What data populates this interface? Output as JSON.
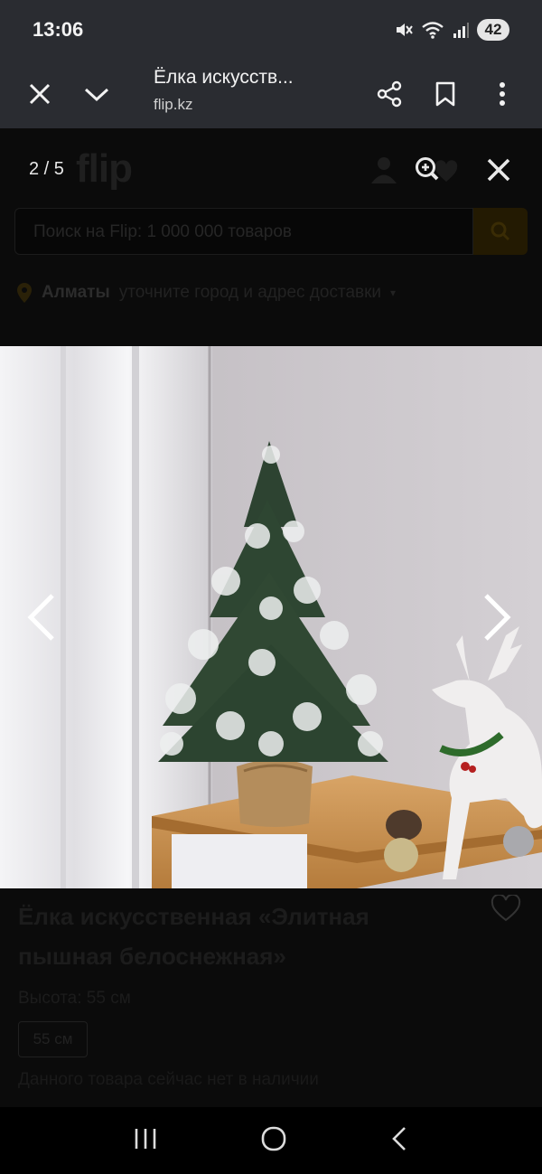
{
  "status": {
    "time": "13:06",
    "battery": "42"
  },
  "browser": {
    "page_title": "Ёлка искусств...",
    "url": "flip.kz"
  },
  "site": {
    "logo_text": "flip",
    "search_placeholder": "Поиск на Flip: 1 000 000 товаров",
    "city": "Алматы",
    "location_hint": "уточните город и адрес доставки",
    "product_title": "Ёлка искусственная «Элитная пышная белоснежная»",
    "height_label": "Высота: 55 см",
    "size_option": "55 см",
    "stock_note": "Данного товара сейчас нет в наличии"
  },
  "gallery": {
    "counter": "2 / 5"
  },
  "icons": {
    "close": "close-icon",
    "collapse": "chevron-down-icon",
    "share": "share-icon",
    "bookmark": "bookmark-icon",
    "menu": "more-vert-icon",
    "zoom": "zoom-in-icon",
    "prev": "chevron-left-icon",
    "next": "chevron-right-icon"
  },
  "colors": {
    "chrome_bg": "#2a2c31",
    "brand_accent": "#f5b400"
  }
}
